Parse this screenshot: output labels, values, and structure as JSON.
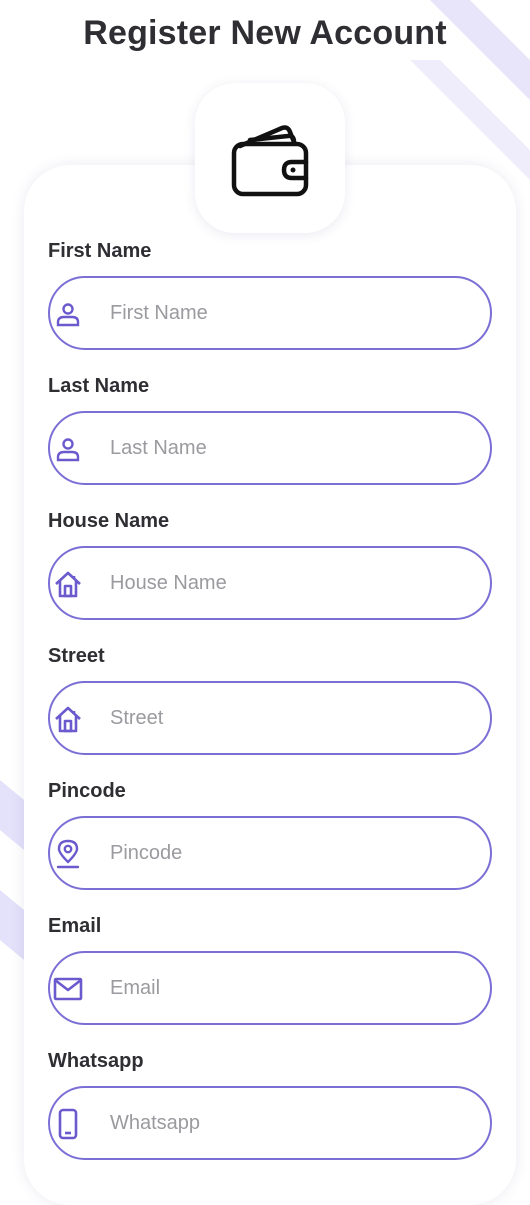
{
  "header": {
    "title": "Register New Account"
  },
  "colors": {
    "accent": "#6a5acd",
    "field_border": "#7b6fd6",
    "text_dark": "#2e2e33",
    "placeholder": "#9a9a9f",
    "decor": "#e4e1fa"
  },
  "form": {
    "fields": [
      {
        "label": "First Name",
        "placeholder": "First Name",
        "icon": "person-icon"
      },
      {
        "label": "Last Name",
        "placeholder": "Last Name",
        "icon": "person-icon"
      },
      {
        "label": "House Name",
        "placeholder": "House Name",
        "icon": "house-icon"
      },
      {
        "label": "Street",
        "placeholder": "Street",
        "icon": "house-icon"
      },
      {
        "label": "Pincode",
        "placeholder": "Pincode",
        "icon": "location-pin-icon"
      },
      {
        "label": "Email",
        "placeholder": "Email",
        "icon": "mail-icon"
      },
      {
        "label": "Whatsapp",
        "placeholder": "Whatsapp",
        "icon": "phone-icon"
      }
    ]
  }
}
